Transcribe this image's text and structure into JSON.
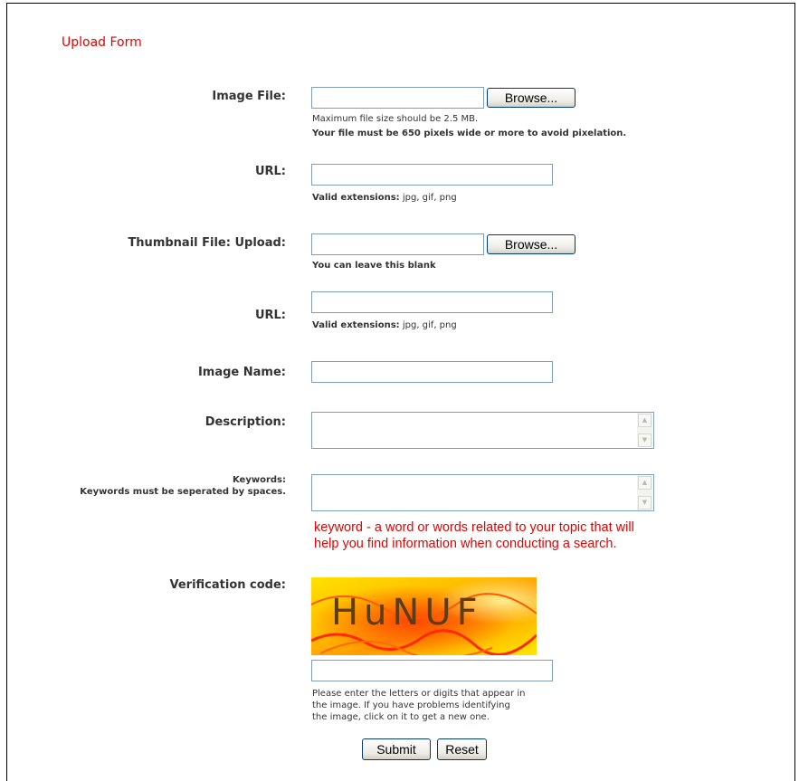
{
  "form": {
    "title": "Upload Form",
    "image_file": {
      "label": "Image File:",
      "browse_label": "Browse...",
      "hint_size": "Maximum file size should be 2.5 MB.",
      "hint_width": "Your file must be 650 pixels wide or more to avoid pixelation."
    },
    "image_url": {
      "label": "URL:",
      "hint_bold": "Valid extensions:",
      "hint_rest": " jpg, gif, png"
    },
    "thumbnail_file": {
      "label": "Thumbnail File: Upload:",
      "browse_label": "Browse...",
      "hint": "You can leave this blank"
    },
    "thumbnail_url": {
      "label": "URL:",
      "hint_bold": "Valid extensions:",
      "hint_rest": " jpg, gif, png"
    },
    "image_name": {
      "label": "Image Name:"
    },
    "description": {
      "label": "Description:"
    },
    "keywords": {
      "label": "Keywords:",
      "sublabel": "Keywords must be seperated by spaces.",
      "note_line1": "keyword - a word or words related to your topic that will",
      "note_line2": "help you find information when conducting a search."
    },
    "verification": {
      "label": "Verification code:",
      "captcha_text": "HuNUF",
      "hint_line1": "Please enter the letters or digits that appear in",
      "hint_line2": "the image. If you have problems identifying",
      "hint_line3": "the image, click on it to get a new one."
    },
    "buttons": {
      "submit": "Submit",
      "reset": "Reset"
    }
  },
  "colors": {
    "accent_red": "#e60000",
    "input_border": "#7f9db9"
  }
}
